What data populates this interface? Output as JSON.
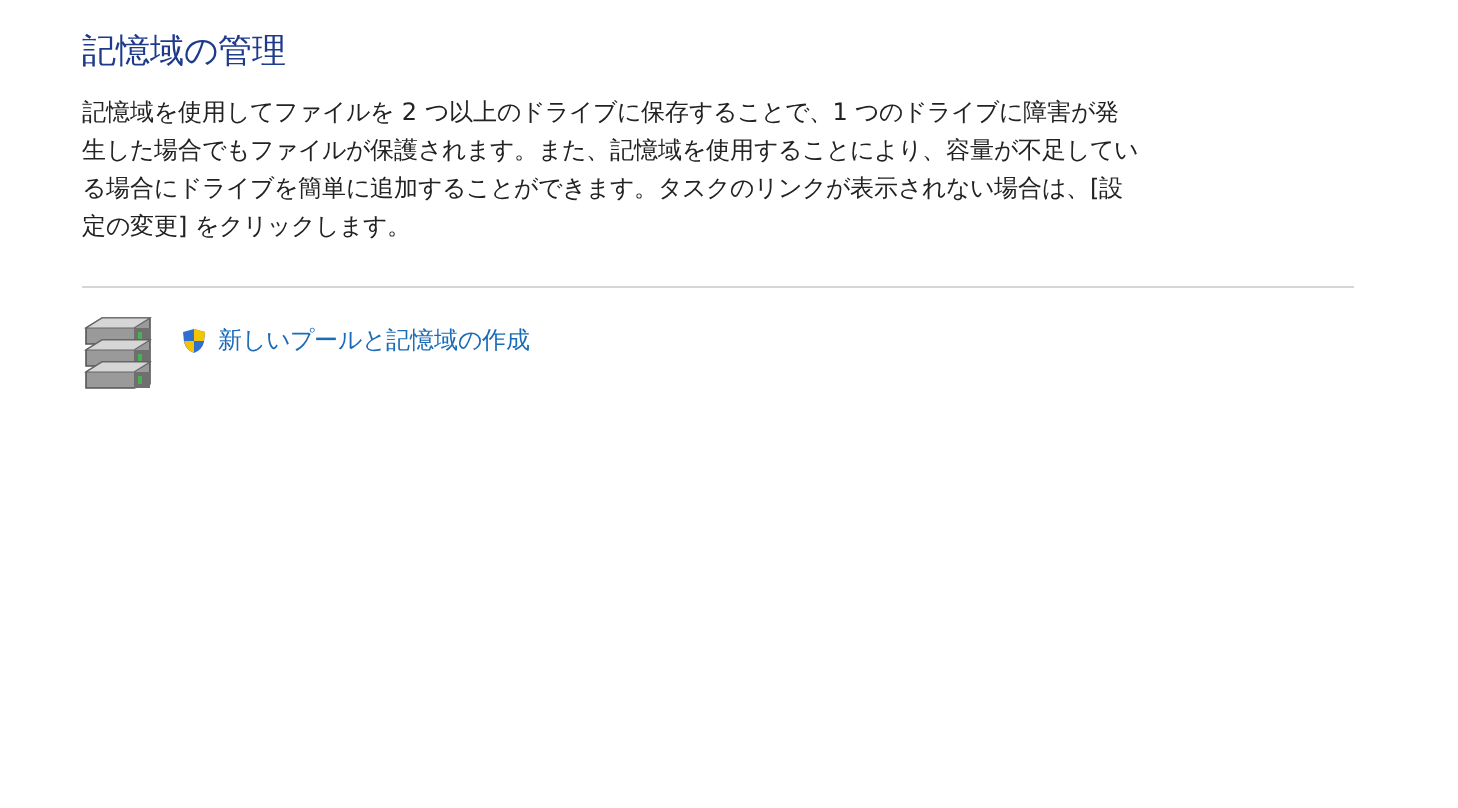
{
  "title": "記憶域の管理",
  "description": "記憶域を使用してファイルを 2 つ以上のドライブに保存することで、1 つのドライブに障害が発生した場合でもファイルが保護されます。また、記憶域を使用することにより、容量が不足している場合にドライブを簡単に追加することができます。タスクのリンクが表示されない場合は、[設定の変更] をクリックします。",
  "tasks": [
    {
      "label": "新しいプールと記憶域の作成",
      "admin_required": true
    }
  ]
}
